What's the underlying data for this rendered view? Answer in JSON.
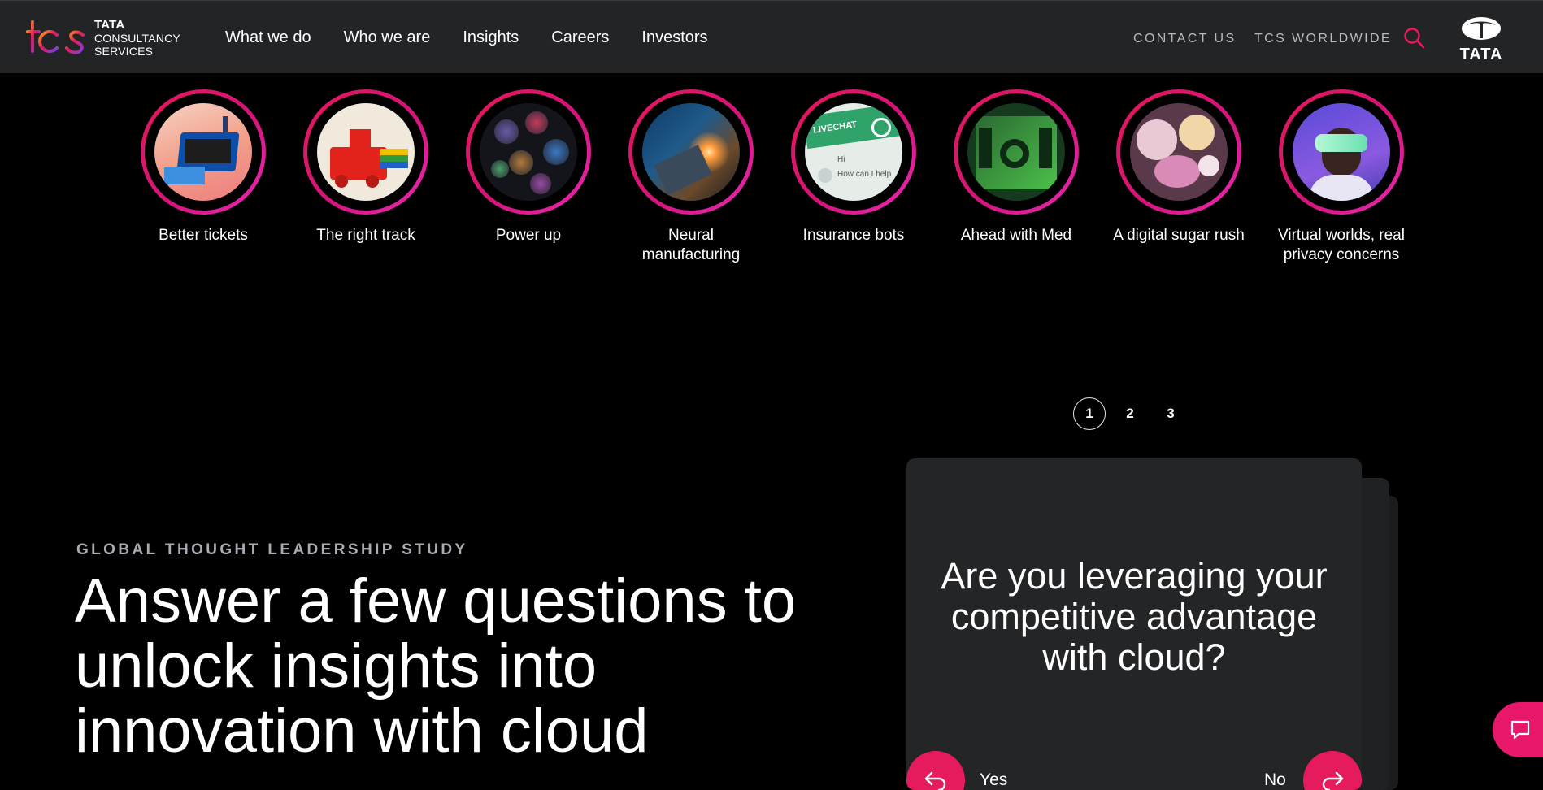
{
  "header": {
    "logo": {
      "mark": "tcs",
      "line1": "TATA",
      "line2": "CONSULTANCY",
      "line3": "SERVICES"
    },
    "nav": [
      "What we do",
      "Who we are",
      "Insights",
      "Careers",
      "Investors"
    ],
    "contact_label": "CONTACT US",
    "worldwide_label": "TCS WORLDWIDE",
    "search_icon": "search-icon",
    "brand_logo_text": "TATA"
  },
  "stories": [
    {
      "label": "Better tickets"
    },
    {
      "label": "The right track"
    },
    {
      "label": "Power up"
    },
    {
      "label": "Neural manufacturing"
    },
    {
      "label": "Insurance bots"
    },
    {
      "label": "Ahead with Med"
    },
    {
      "label": "A digital sugar rush"
    },
    {
      "label": "Virtual worlds, real privacy concerns"
    }
  ],
  "story_thumb_text": {
    "livechat": "LIVECHAT",
    "chat_hi": "Hi",
    "chat_line": "How can I help"
  },
  "hero": {
    "eyebrow": "GLOBAL THOUGHT LEADERSHIP STUDY",
    "headline": "Answer a few questions to unlock insights into innovation with cloud"
  },
  "pager": {
    "pages": [
      "1",
      "2",
      "3"
    ],
    "active": "1"
  },
  "quiz": {
    "question": "Are you leveraging your competitive advantage with cloud?",
    "yes_label": "Yes",
    "no_label": "No"
  },
  "colors": {
    "accent": "#e61b5d",
    "header_bg": "#222425",
    "card_bg": "#242526"
  }
}
